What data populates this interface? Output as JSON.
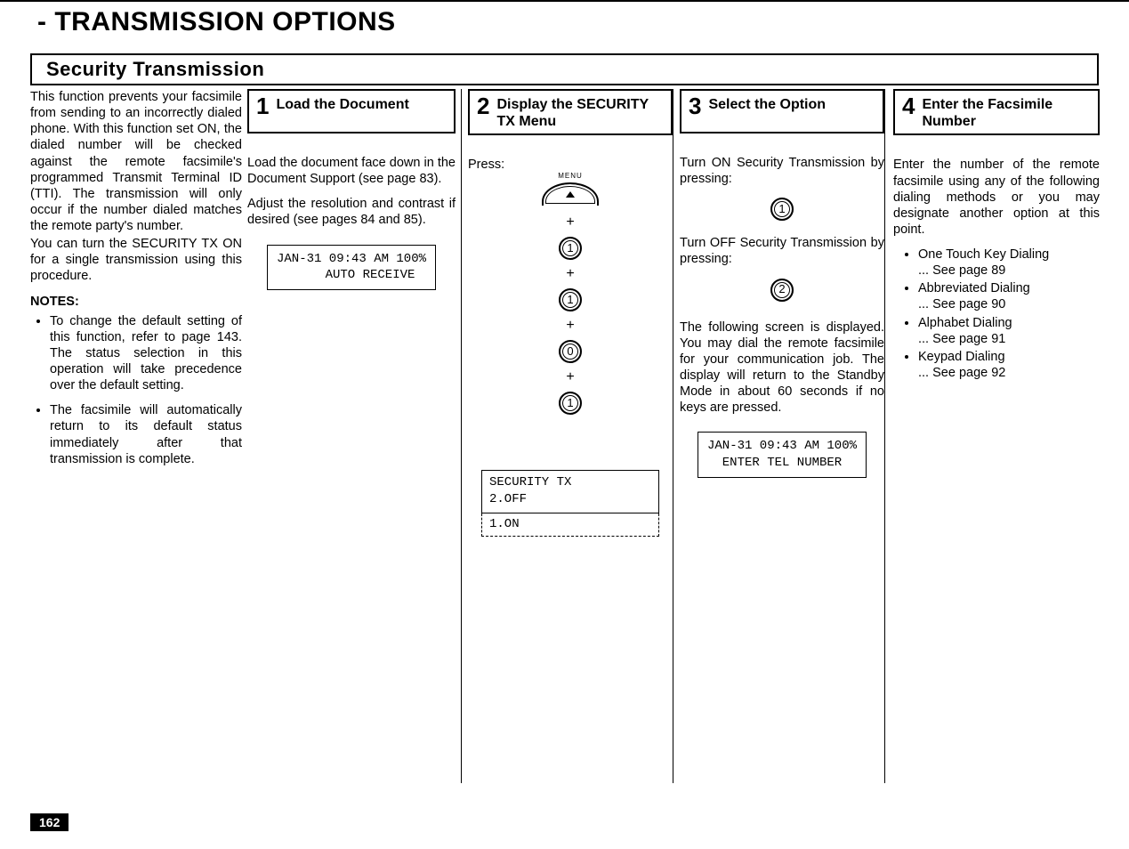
{
  "chapter": "- TRANSMISSION OPTIONS",
  "section": "Security  Transmission",
  "intro": {
    "para1": "This function prevents your facsimile from sending to an incorrectly dialed phone. With this function set ON, the dialed number will be checked against the remote facsimile's programmed Transmit Terminal ID (TTI). The transmission will only occur if the number dialed matches the remote party's number.",
    "para2": "You can turn the SECURITY TX ON for a single transmission using this procedure.",
    "notes_head": "NOTES:",
    "note1": "To change the default setting of this function, refer to page 143. The status selection in this operation will take precedence over the default setting.",
    "note2": "The facsimile will automatically return to its default status immediately after that transmission is complete."
  },
  "steps": {
    "s1": {
      "num": "1",
      "title": "Load the Document",
      "p1": "Load the document face down in the Document Support (see page 83).",
      "p2": "Adjust the resolution and contrast if desired (see pages 84 and 85).",
      "lcd": "JAN-31 09:43 AM 100%\n     AUTO RECEIVE"
    },
    "s2": {
      "num": "2",
      "title": "Display the SECURITY TX Menu",
      "press": "Press:",
      "menu_label": "MENU",
      "k1": "1",
      "k2": "1",
      "k3": "0",
      "k4": "1",
      "sec_line1": "SECURITY TX\n2.OFF",
      "sec_line2": " 1.ON"
    },
    "s3": {
      "num": "3",
      "title": "Select the Option",
      "on_text": "Turn ON Security Transmission by pressing:",
      "on_key": "1",
      "off_text": "Turn OFF Security Transmission by pressing:",
      "off_key": "2",
      "after": "The following screen is displayed. You may dial the remote facsimile for your communication job. The display will return to the Standby Mode in about 60 seconds if no keys are pressed.",
      "lcd": "JAN-31 09:43 AM 100%\nENTER TEL NUMBER"
    },
    "s4": {
      "num": "4",
      "title": "Enter the Facsimile Number",
      "p1": "Enter the number of the remote facsimile using any of the following dialing methods or you may designate another option at this point.",
      "d1a": "One Touch Key Dialing",
      "d1b": "... See page 89",
      "d2a": "Abbreviated Dialing",
      "d2b": "... See page 90",
      "d3a": "Alphabet Dialing",
      "d3b": "... See page 91",
      "d4a": "Keypad Dialing",
      "d4b": "... See page 92"
    }
  },
  "page_number": "162"
}
